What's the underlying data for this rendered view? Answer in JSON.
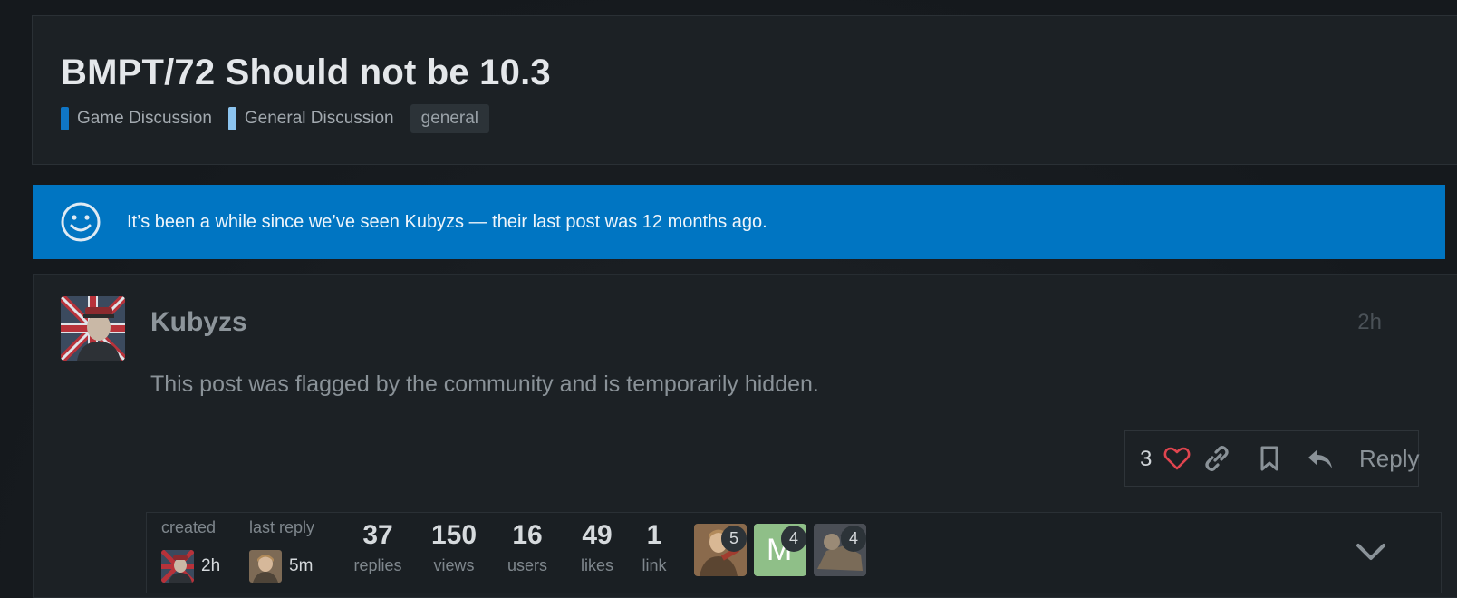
{
  "topic": {
    "title": "BMPT/72 Should not be 10.3",
    "categories": [
      {
        "label": "Game Discussion",
        "color": "#0f76c6"
      },
      {
        "label": "General Discussion",
        "color": "#8cc4ef"
      }
    ],
    "tag": "general"
  },
  "banner": {
    "icon": "smile-icon",
    "text": "It’s been a while since we’ve seen Kubyzs — their last post was 12 months ago.",
    "color": "#0075c2"
  },
  "post": {
    "username": "Kubyzs",
    "time": "2h",
    "body": "This post was flagged by the community and is temporarily hidden.",
    "like_count": "3",
    "reply_label": "Reply"
  },
  "topic_map": {
    "created_label": "created",
    "created_time": "2h",
    "last_reply_label": "last reply",
    "last_reply_time": "5m",
    "stats": [
      {
        "num": "37",
        "label": "replies"
      },
      {
        "num": "150",
        "label": "views"
      },
      {
        "num": "16",
        "label": "users"
      },
      {
        "num": "49",
        "label": "likes"
      },
      {
        "num": "1",
        "label": "link"
      }
    ],
    "posters": [
      {
        "count": "5"
      },
      {
        "letter": "M",
        "count": "4",
        "color": "#8fbf88"
      },
      {
        "count": "4"
      }
    ]
  }
}
